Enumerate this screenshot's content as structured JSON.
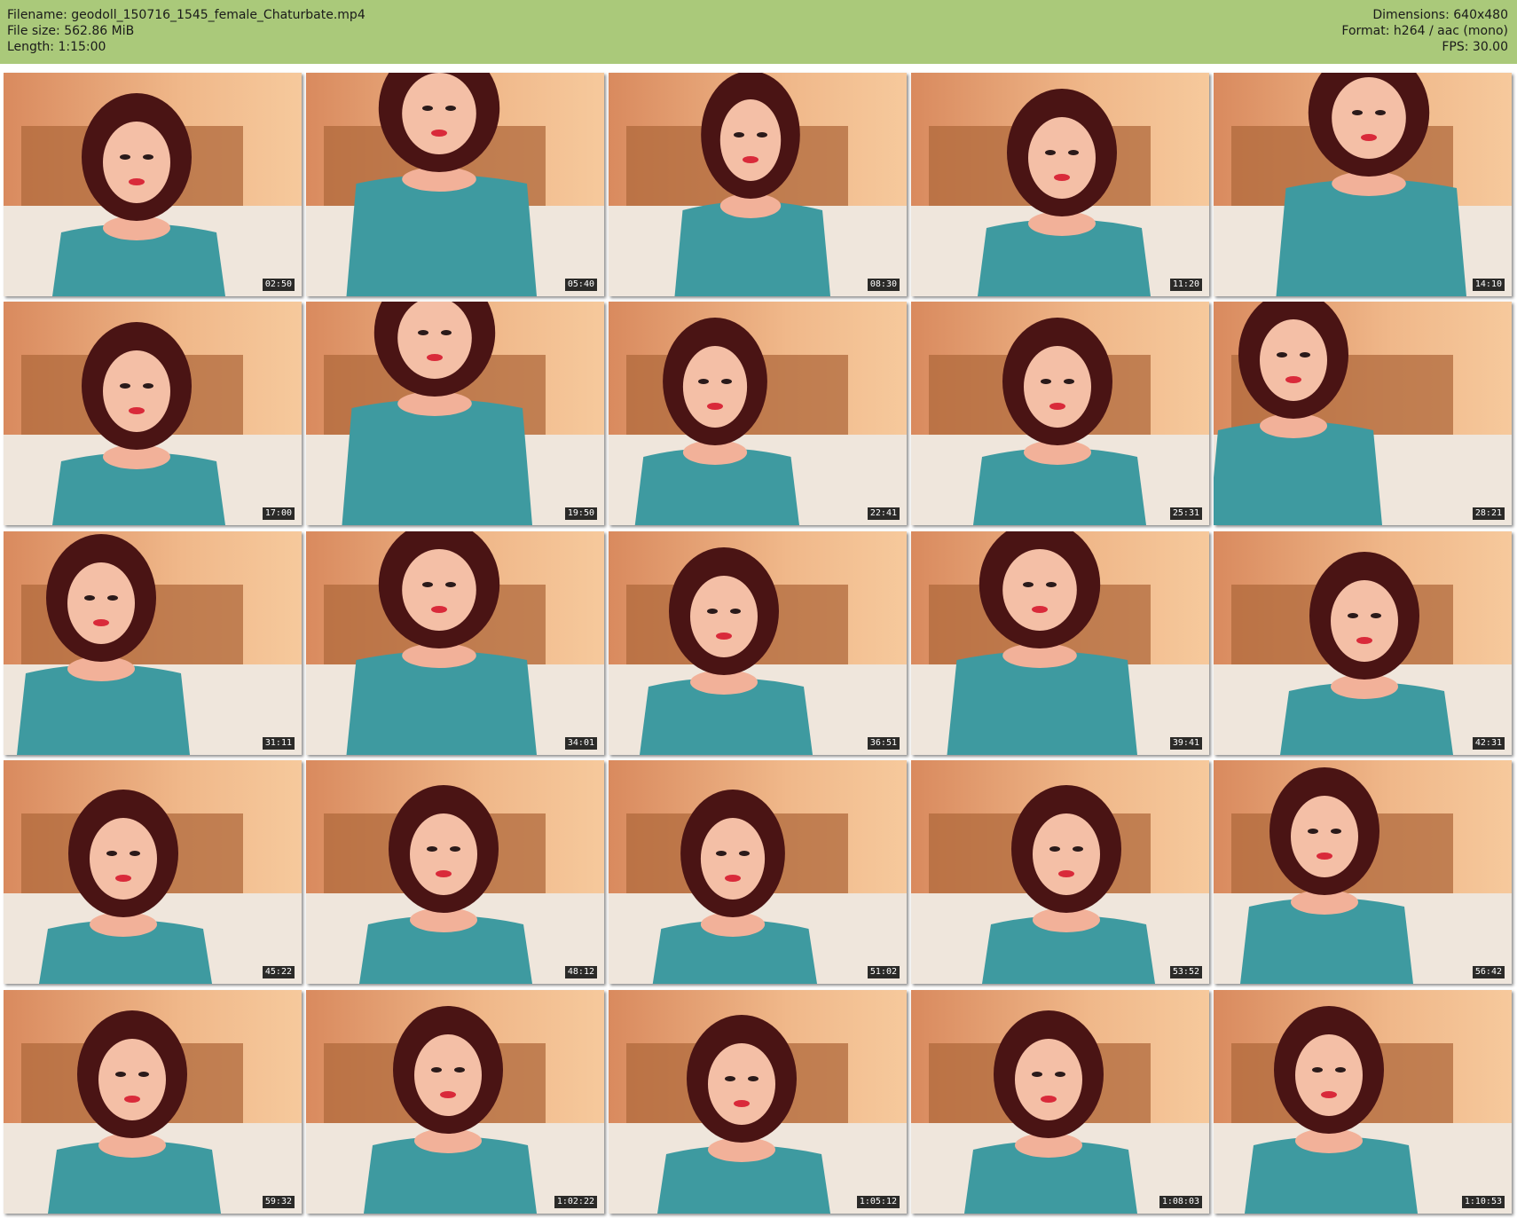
{
  "header": {
    "bg": "#aac97a",
    "left": [
      "Filename: geodoll_150716_1545_female_Chaturbate.mp4",
      "File size: 562.86 MiB",
      "Length: 1:15:00"
    ],
    "right": [
      "Dimensions: 640x480",
      "Format: h264 / aac (mono)",
      "FPS: 30.00"
    ]
  },
  "thumbnails": [
    {
      "time": "02:50"
    },
    {
      "time": "05:40"
    },
    {
      "time": "08:30"
    },
    {
      "time": "11:20"
    },
    {
      "time": "14:10"
    },
    {
      "time": "17:00"
    },
    {
      "time": "19:50"
    },
    {
      "time": "22:41"
    },
    {
      "time": "25:31"
    },
    {
      "time": "28:21"
    },
    {
      "time": "31:11"
    },
    {
      "time": "34:01"
    },
    {
      "time": "36:51"
    },
    {
      "time": "39:41"
    },
    {
      "time": "42:31"
    },
    {
      "time": "45:22"
    },
    {
      "time": "48:12"
    },
    {
      "time": "51:02"
    },
    {
      "time": "53:52"
    },
    {
      "time": "56:42"
    },
    {
      "time": "59:32"
    },
    {
      "time": "1:02:22"
    },
    {
      "time": "1:05:12"
    },
    {
      "time": "1:08:03"
    },
    {
      "time": "1:10:53"
    }
  ]
}
